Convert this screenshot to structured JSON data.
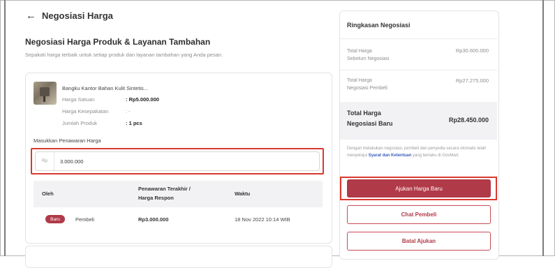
{
  "header": {
    "back_title": "Negosiasi Harga"
  },
  "main": {
    "title": "Negosiasi Harga Produk & Layanan Tambahan",
    "subtitle": "Sepakati harga terbaik untuk setiap produk dan layanan tambahan yang Anda pesan."
  },
  "product": {
    "name": "Bangku Kantor Bahan Kulit Sintetis...",
    "unit_price_label": "Harga Satuan",
    "unit_price_value": ": Rp5.000.000",
    "agreed_price_label": "Harga Kesepakatan",
    "agreed_price_value": ": -",
    "qty_label": "Jumlah Produk",
    "qty_value": ": 1 pcs"
  },
  "offer": {
    "label": "Masukkan Penawaran Harga",
    "prefix": "Rp",
    "value": "3.000.000"
  },
  "table": {
    "headers": {
      "by": "Oleh",
      "last_offer_line1": "Penawaran Terakhir /",
      "last_offer_line2": "Harga Respon",
      "time": "Waktu"
    },
    "row": {
      "badge": "Baru",
      "by": "Pembeli",
      "price": "Rp3.000.000",
      "time": "18 Nov 2022 10:14 WIB"
    }
  },
  "summary": {
    "title": "Ringkasan Negosiasi",
    "before_label_1": "Total Harga",
    "before_label_2": "Sebelum Negosiasi",
    "before_value": "Rp30.600.000",
    "buyer_label_1": "Total Harga",
    "buyer_label_2": "Negosiasi Pembeli",
    "buyer_value": "Rp27.275.000",
    "new_label_1": "Total Harga",
    "new_label_2": "Negosiasi Baru",
    "new_value": "Rp28.450.000",
    "terms_prefix": "Dengan melakukan negosiasi, pembeli dan penyedia secara otomatis telah menyetujui",
    "terms_link": "Syarat dan Ketentuan",
    "terms_suffix": "yang berlaku di GovMart."
  },
  "actions": {
    "submit": "Ajukan Harga Baru",
    "chat": "Chat Pembeli",
    "cancel": "Batal Ajukan"
  },
  "colors": {
    "primary": "#b13a48",
    "highlight": "#d8392f",
    "link": "#3a5db8"
  }
}
